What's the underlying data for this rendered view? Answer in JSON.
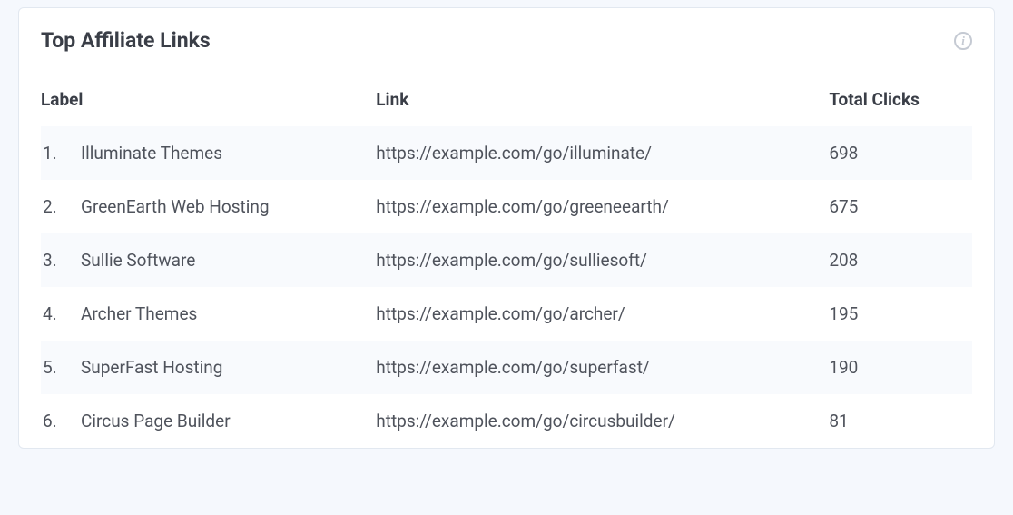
{
  "card": {
    "title": "Top Affiliate Links"
  },
  "columns": {
    "label": "Label",
    "link": "Link",
    "clicks": "Total Clicks"
  },
  "rows": [
    {
      "num": "1.",
      "label": "Illuminate Themes",
      "link": "https://example.com/go/illuminate/",
      "clicks": "698"
    },
    {
      "num": "2.",
      "label": "GreenEarth Web Hosting",
      "link": "https://example.com/go/greeneearth/",
      "clicks": "675"
    },
    {
      "num": "3.",
      "label": "Sullie Software",
      "link": "https://example.com/go/sulliesoft/",
      "clicks": "208"
    },
    {
      "num": "4.",
      "label": "Archer Themes",
      "link": "https://example.com/go/archer/",
      "clicks": "195"
    },
    {
      "num": "5.",
      "label": "SuperFast Hosting",
      "link": "https://example.com/go/superfast/",
      "clicks": "190"
    },
    {
      "num": "6.",
      "label": "Circus Page Builder",
      "link": "https://example.com/go/circusbuilder/",
      "clicks": "81"
    }
  ],
  "info_glyph": "i"
}
